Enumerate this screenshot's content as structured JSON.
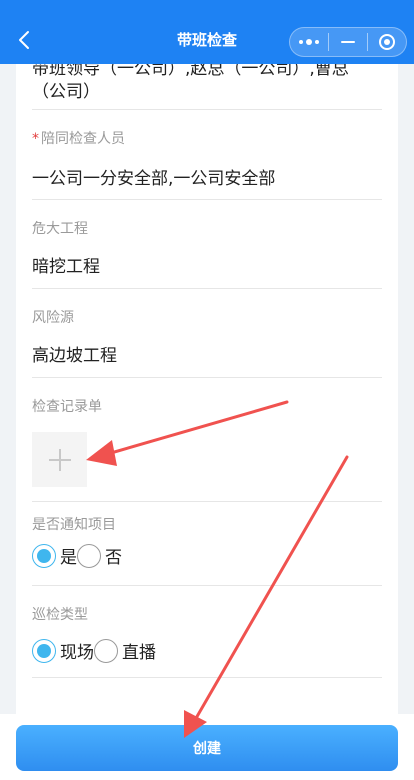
{
  "nav": {
    "title": "带班检查",
    "back_icon": "chevron-left-icon",
    "more_icon": "more-dots-icon",
    "minimize_icon": "minus-icon",
    "close_icon": "target-circle-icon",
    "color": "#1e82f3"
  },
  "form": {
    "leader_text": "带班领导（一公司）,赵总（一公司）,曹总（公司）",
    "accompany": {
      "label": "陪同检查人员",
      "required_mark": "*",
      "value": "一公司一分安全部,一公司安全部"
    },
    "project": {
      "label": "危大工程",
      "value": "暗挖工程"
    },
    "risk": {
      "label": "风险源",
      "value": "高边坡工程"
    },
    "record": {
      "label": "检查记录单",
      "upload_icon": "plus-icon"
    },
    "notify": {
      "label": "是否通知项目",
      "options": [
        {
          "label": "是",
          "selected": true
        },
        {
          "label": "否",
          "selected": false
        }
      ]
    },
    "inspect_type": {
      "label": "巡检类型",
      "options": [
        {
          "label": "现场",
          "selected": true
        },
        {
          "label": "直播",
          "selected": false
        }
      ]
    }
  },
  "footer": {
    "create_label": "创建"
  },
  "annotation": {
    "color": "#f0524f"
  }
}
